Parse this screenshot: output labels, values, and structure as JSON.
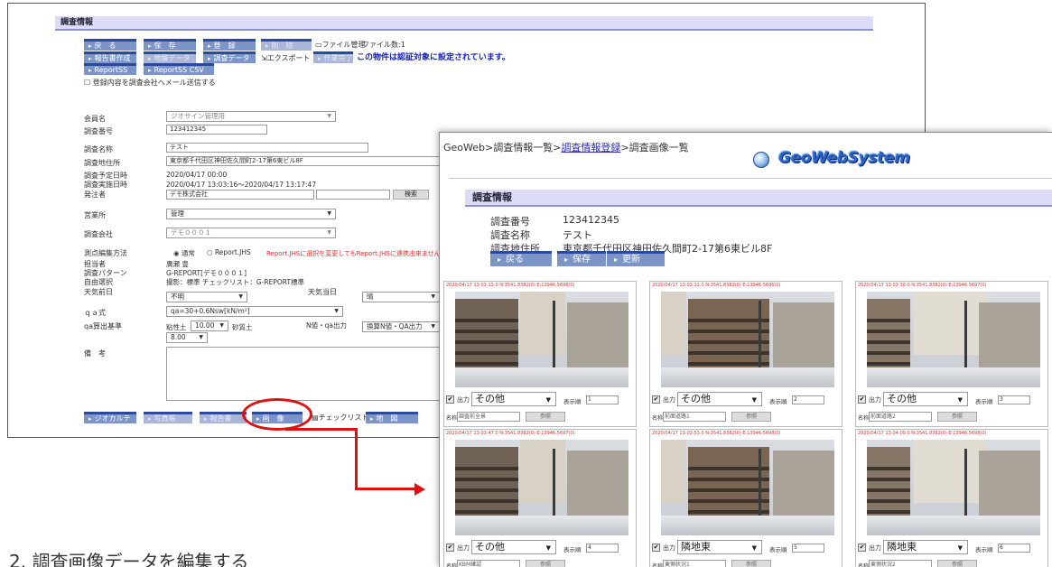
{
  "win1": {
    "section_title": "調査情報",
    "toolbar_row1": [
      "戻　る",
      "保　存",
      "登　録",
      "削　除"
    ],
    "file_mgmt_label": "ファイル管理",
    "file_count": "ファイル数:1",
    "toolbar_row2": [
      "報告書作成",
      "地盤データ",
      "調査データ",
      "エクスポート",
      "作業完了"
    ],
    "notice": "この物件は認証対象に設定されています。",
    "toolbar_row3": [
      "ReportSS",
      "ReportSS CSV"
    ],
    "mail_checkbox_label": "登録内容を調査会社へメール送信する",
    "fields": {
      "member_label": "会員名",
      "member_value": "ジオサイン管理用",
      "survey_no_label": "調査番号",
      "survey_no_value": "123412345",
      "survey_name_label": "調査名称",
      "survey_name_value": "テスト",
      "address_label": "調査地住所",
      "address_value": "東京都千代田区神田佐久間町2-17第6東ビル8F",
      "planned_date_label": "調査予定日時",
      "planned_date_value": "2020/04/17 00:00",
      "actual_date_label": "調査実施日時",
      "actual_date_value": "2020/04/17 13:03:16～2020/04/17 13:17:47",
      "client_label": "発注者",
      "client_value": "デモ株式会社",
      "search_button": "検索",
      "office_label": "営業所",
      "office_value": "管理",
      "company_label": "調査会社",
      "company_value": "デモ０００１",
      "method_label": "測点編集方法",
      "method_normal": "通常",
      "method_jhs": "Report.JHS",
      "method_note": "Report.JHSに選択を変更してもReport.JHSに連携出来ません",
      "person_label": "担当者",
      "person_value": "廣瀬 豊",
      "pattern_label": "調査パターン",
      "pattern_value": "G-REPORT[デモ０００１]",
      "free_label": "自由選択",
      "free_value": "撮影：標準 チェックリスト：G-REPORT標準",
      "weather_prev_label": "天気前日",
      "weather_prev_value": "不明",
      "weather_day_label": "天気当日",
      "weather_day_value": "晴",
      "qa_label": "ｑａ式",
      "qa_value": "qa=30+0.6Nsw[kN/m²]",
      "qa_basis_label": "qa算出基準",
      "clay_label": "粘性土",
      "clay_value": "10.00",
      "sand_label": "砂質土",
      "sand_value": "8.00",
      "nqa_label": "N値・qa出力",
      "nqa_value": "換算N値・QA出力",
      "remarks_label": "備　考"
    },
    "bottom_buttons": [
      "ジオカルテ",
      "写真帳",
      "報告書",
      "画　像",
      "チェックリスト",
      "地　図"
    ]
  },
  "win2": {
    "breadcrumb_a": "GeoWeb>調査情報一覧>",
    "breadcrumb_link": "調査情報登録",
    "breadcrumb_b": ">調査画像一覧",
    "logo": "GeoWebSystem",
    "section_title": "調査情報",
    "survey_no_label": "調査番号",
    "survey_no_value": "123412345",
    "survey_name_label": "調査名称",
    "survey_name_value": "テスト",
    "address_label": "調査地住所",
    "address_value": "東京都千代田区神田佐久間町2-17第6東ビル8F",
    "buttons": [
      "戻る",
      "保存",
      "更新"
    ],
    "cards": [
      {
        "stamp": "2020/04/17 13:03:13.0 N:3541.8382(0) E:13946.5698(0)",
        "output_label": "出力",
        "select": "その他",
        "order_label": "表示順",
        "order": "1",
        "name_label": "名称",
        "name": "調査前全景",
        "ref_button": "参照"
      },
      {
        "stamp": "2020/04/17 13:03:22.0 N:3541.8382(0) E:13946.5696(0)",
        "output_label": "出力",
        "select": "その他",
        "order_label": "表示順",
        "order": "2",
        "name_label": "名称",
        "name": "前面道路1",
        "ref_button": "参照"
      },
      {
        "stamp": "2020/04/17 13:03:30.0 N:3541.8382(0) E:13946.5697(0)",
        "output_label": "出力",
        "select": "その他",
        "order_label": "表示順",
        "order": "3",
        "name_label": "名称",
        "name": "前面道路2",
        "ref_button": "参照"
      },
      {
        "stamp": "2020/04/17 13:03:47.0 N:3541.8382(0) E:13946.5697(0)",
        "output_label": "出力",
        "select": "その他",
        "order_label": "表示順",
        "order": "4",
        "name_label": "名称",
        "name": "KBM確認",
        "ref_button": "参照"
      },
      {
        "stamp": "2020/04/17 13:03:53.0 N:3541.8382(0) E:13946.5698(0)",
        "output_label": "出力",
        "select": "隣地東",
        "order_label": "表示順",
        "order": "5",
        "name_label": "名称",
        "name": "東側状況1",
        "ref_button": "参照"
      },
      {
        "stamp": "2020/04/17 13:04:00.0 N:3541.8382(0) E:13946.5698(0)",
        "output_label": "出力",
        "select": "隣地東",
        "order_label": "表示順",
        "order": "6",
        "name_label": "名称",
        "name": "東側状況2",
        "ref_button": "参照"
      }
    ]
  },
  "caption": "2. 調査画像データを編集する",
  "colors": {
    "highlight": "#e01010",
    "section_bg": "#dcdcf6",
    "button_bg": "#7c95c9",
    "notice": "#1422b8"
  }
}
